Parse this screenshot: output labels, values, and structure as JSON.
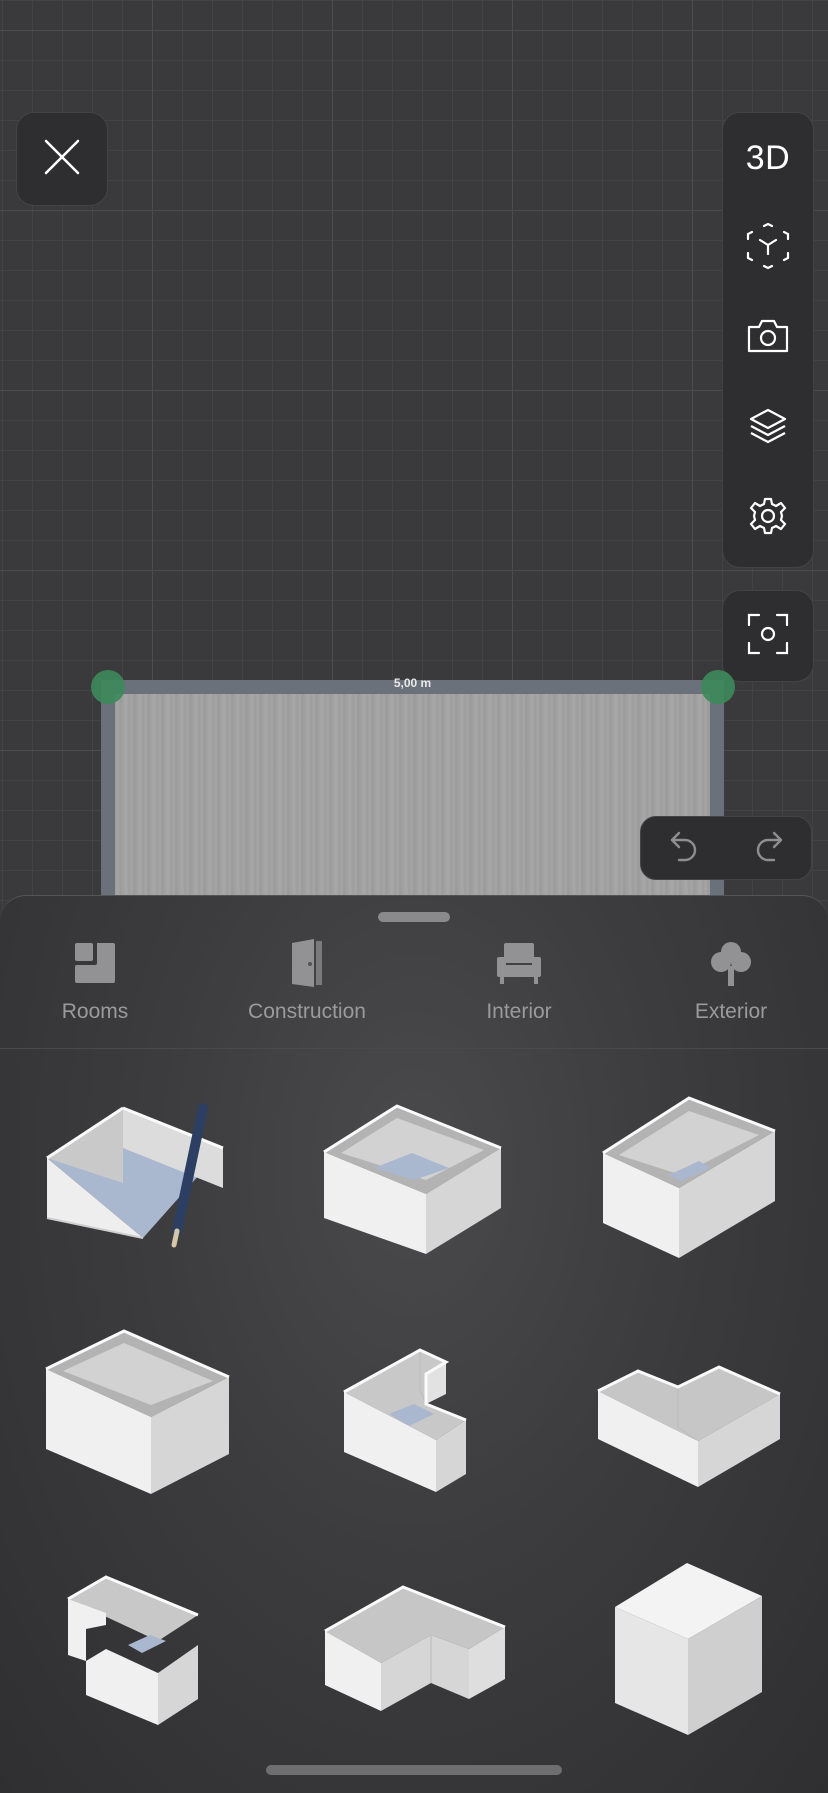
{
  "canvas": {
    "room_dimension_label": "5,00 m"
  },
  "toolbar": {
    "view_toggle_label": "3D",
    "close_icon": "close-icon",
    "items": [
      "3d-toggle",
      "ar-cube-icon",
      "camera-icon",
      "layers-icon",
      "gear-icon"
    ]
  },
  "tabs": [
    {
      "label": "Rooms",
      "icon": "rooms-icon"
    },
    {
      "label": "Construction",
      "icon": "door-icon"
    },
    {
      "label": "Interior",
      "icon": "armchair-icon"
    },
    {
      "label": "Exterior",
      "icon": "tree-icon"
    }
  ],
  "room_templates": [
    {
      "name": "draw-room"
    },
    {
      "name": "square-room"
    },
    {
      "name": "rectangle-room"
    },
    {
      "name": "wide-rectangle-room"
    },
    {
      "name": "notched-room"
    },
    {
      "name": "l-shaped-room"
    },
    {
      "name": "stepped-room"
    },
    {
      "name": "t-shaped-room"
    },
    {
      "name": "solid-cube"
    }
  ]
}
